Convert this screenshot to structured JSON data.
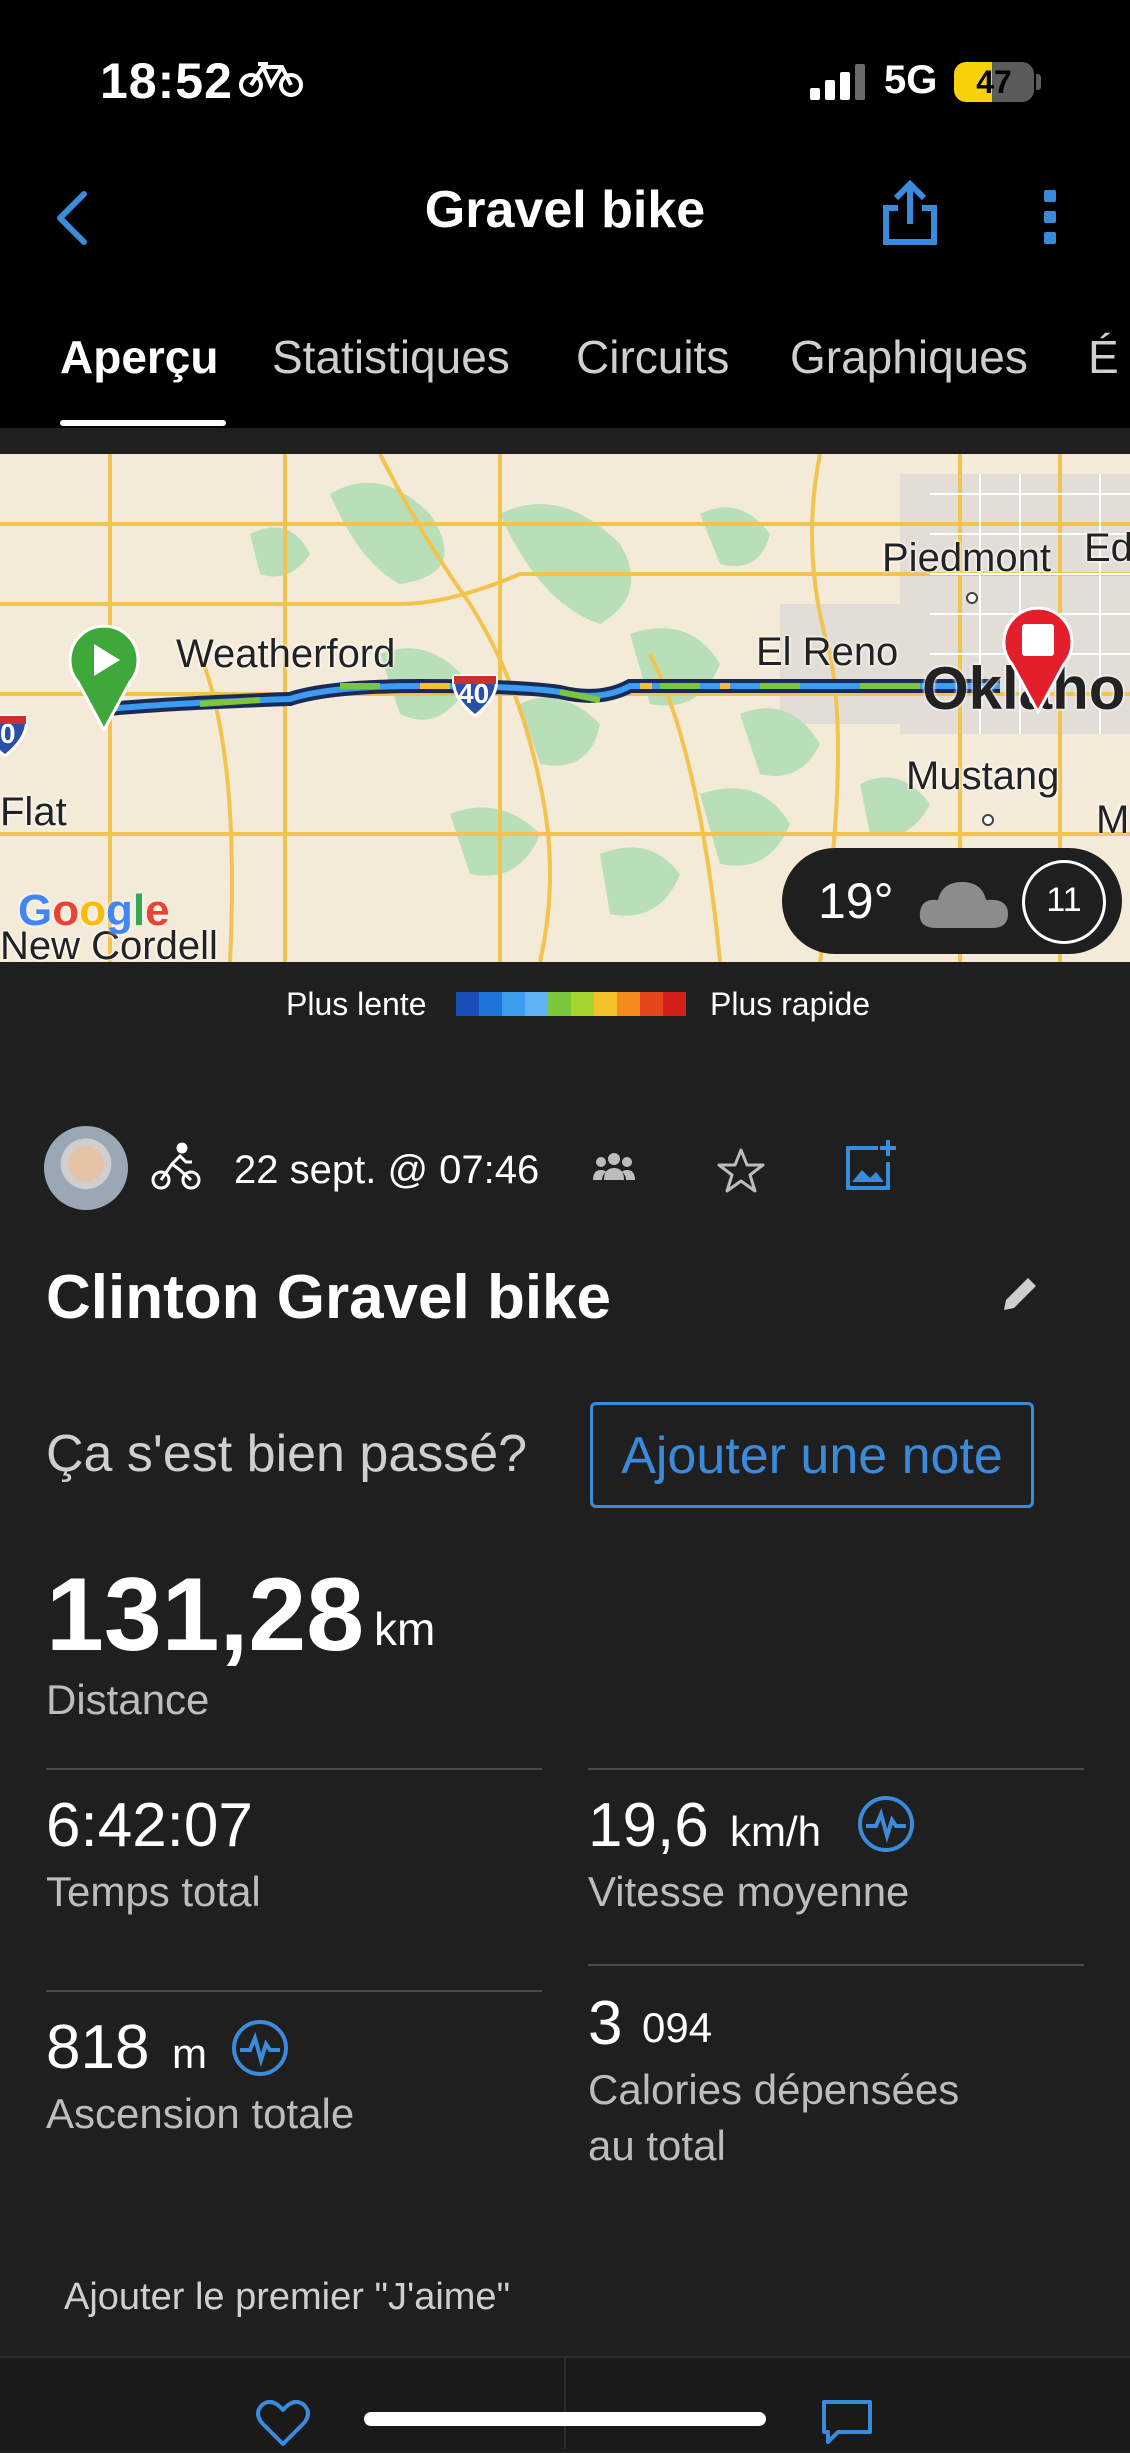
{
  "status": {
    "time": "18:52",
    "network": "5G",
    "battery": "47",
    "battery_fraction": 0.47
  },
  "header": {
    "title": "Gravel bike",
    "back_icon": "chevron-left-icon",
    "share_icon": "share-icon",
    "more_icon": "more-vertical-icon"
  },
  "tabs": [
    {
      "label": "Aperçu",
      "active": true
    },
    {
      "label": "Statistiques",
      "active": false
    },
    {
      "label": "Circuits",
      "active": false
    },
    {
      "label": "Graphiques",
      "active": false
    },
    {
      "label": "É",
      "active": false
    }
  ],
  "map": {
    "labels": [
      "Weatherford",
      "El Reno",
      "Piedmont",
      "Ed",
      "Oklaho",
      "Mustang",
      "Flat",
      "New Cordell",
      "M",
      "40",
      "0"
    ],
    "attribution": "Google",
    "weather": {
      "temperature": "19°",
      "icon": "cloud-icon",
      "wind": "11"
    }
  },
  "legend": {
    "slow": "Plus lente",
    "fast": "Plus rapide",
    "colors": [
      "#1b4fb8",
      "#1f74d8",
      "#3b9cf0",
      "#5fb3f5",
      "#7bc63a",
      "#a6d42f",
      "#f4c12a",
      "#f58a1f",
      "#e5461c",
      "#d4201a"
    ]
  },
  "activity": {
    "type_icon": "cycling-icon",
    "datetime": "22 sept. @ 07:46",
    "title": "Clinton Gravel bike",
    "question": "Ça s'est bien passé?",
    "note_button": "Ajouter une note"
  },
  "stats": {
    "distance": {
      "value": "131,28",
      "unit": "km",
      "label": "Distance"
    },
    "total_time": {
      "value": "6:42:07",
      "label": "Temps total"
    },
    "avg_speed": {
      "value": "19,6",
      "unit": "km/h",
      "label": "Vitesse moyenne"
    },
    "ascent": {
      "value": "818",
      "unit": "m",
      "label": "Ascension totale"
    },
    "calories": {
      "value_big": "3",
      "value_small": "094",
      "label_line1": "Calories dépensées",
      "label_line2": "au total"
    }
  },
  "social": {
    "first_like": "Ajouter le premier \"J'aime\""
  }
}
